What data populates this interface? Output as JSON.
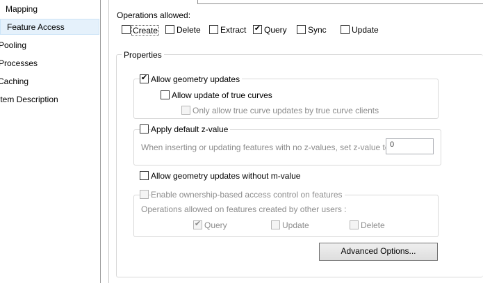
{
  "nav": {
    "items": [
      {
        "label": "Mapping"
      },
      {
        "label": "Feature Access",
        "selected": true
      },
      {
        "label": "Pooling"
      },
      {
        "label": "Processes"
      },
      {
        "label": "Caching"
      },
      {
        "label": "Item Description"
      }
    ]
  },
  "operations": {
    "label": "Operations allowed:",
    "items": [
      {
        "label": "Create",
        "checked": false
      },
      {
        "label": "Delete",
        "checked": false
      },
      {
        "label": "Extract",
        "checked": false
      },
      {
        "label": "Query",
        "checked": true
      },
      {
        "label": "Sync",
        "checked": false
      },
      {
        "label": "Update",
        "checked": false
      }
    ]
  },
  "properties": {
    "title": "Properties",
    "allow_geometry_updates": "Allow geometry updates",
    "allow_true_curves": "Allow update of true curves",
    "only_true_curve_clients": "Only allow true curve updates by true curve clients",
    "apply_default_z": "Apply default z-value",
    "z_value_text": "When inserting or updating features with no z-values, set z-value to:",
    "z_value": "0",
    "allow_without_m": "Allow geometry updates without m-value",
    "ownership": "Enable ownership-based access control on features",
    "ownership_text": "Operations allowed on features created by other users :",
    "owner_ops": [
      {
        "label": "Query",
        "checked": true
      },
      {
        "label": "Update",
        "checked": false
      },
      {
        "label": "Delete",
        "checked": false
      }
    ],
    "advanced_button": "Advanced Options..."
  },
  "icons": {
    "checkmark": "checkmark-icon"
  }
}
